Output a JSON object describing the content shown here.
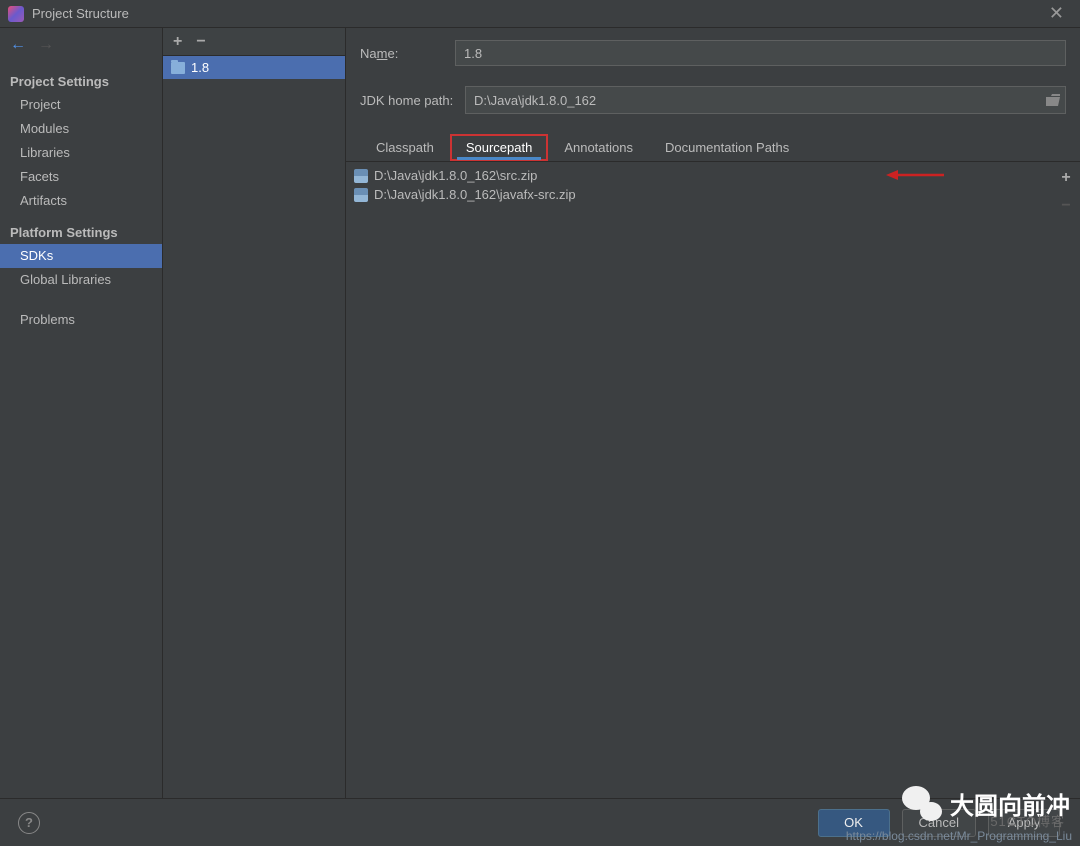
{
  "window": {
    "title": "Project Structure"
  },
  "sidebar": {
    "section1": "Project Settings",
    "items1": [
      "Project",
      "Modules",
      "Libraries",
      "Facets",
      "Artifacts"
    ],
    "section2": "Platform Settings",
    "items2": [
      "SDKs",
      "Global Libraries"
    ],
    "section3_item": "Problems"
  },
  "sdk_list": {
    "selected": "1.8"
  },
  "form": {
    "name_label": "Name:",
    "name_value": "1.8",
    "path_label": "JDK home path:",
    "path_value": "D:\\Java\\jdk1.8.0_162"
  },
  "tabs": [
    "Classpath",
    "Sourcepath",
    "Annotations",
    "Documentation Paths"
  ],
  "sourcepaths": [
    "D:\\Java\\jdk1.8.0_162\\src.zip",
    "D:\\Java\\jdk1.8.0_162\\javafx-src.zip"
  ],
  "buttons": {
    "ok": "OK",
    "cancel": "Cancel",
    "apply": "Apply"
  },
  "watermark": {
    "text": "大圆向前冲",
    "url": "https://blog.csdn.net/Mr_Programming_Liu",
    "faint": "51CTO博客"
  }
}
